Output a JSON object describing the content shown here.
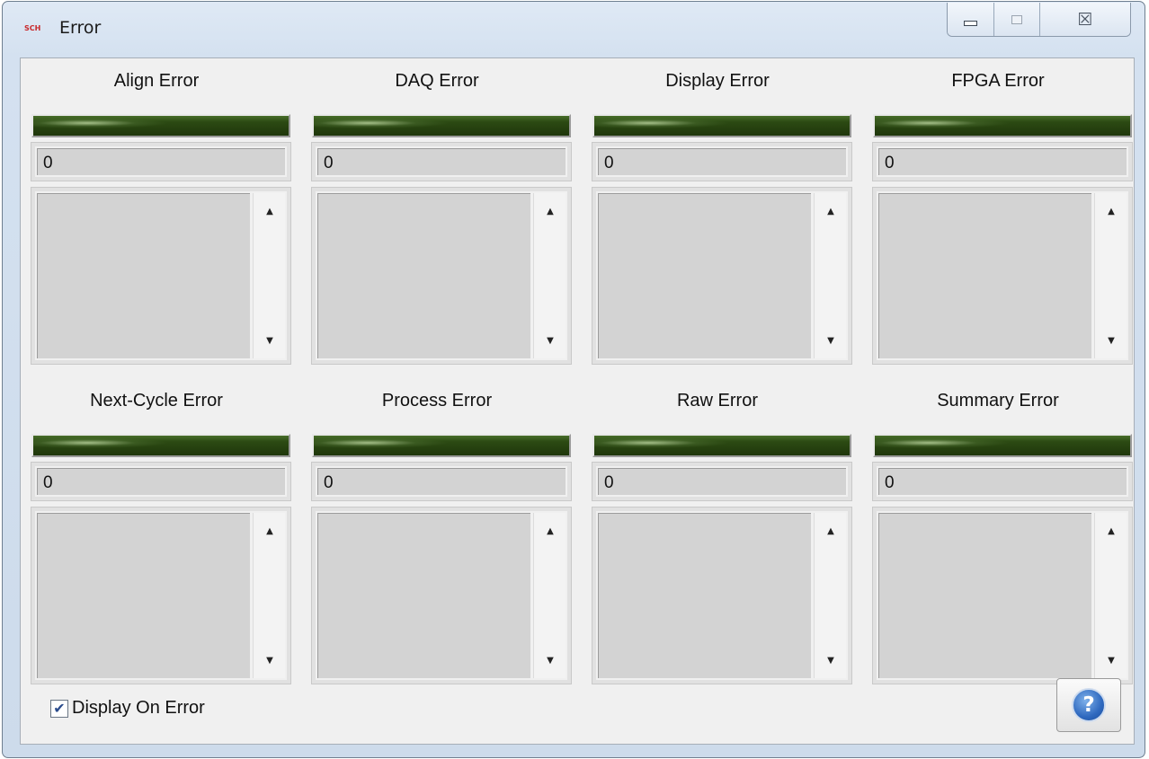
{
  "window": {
    "title": "Error",
    "icon_text": "SCH",
    "icon_name": "app-logo-icon",
    "caption": {
      "minimize_icon": "minimize-icon",
      "maximize_icon": "maximize-icon",
      "close_glyph": "☒"
    }
  },
  "tiles": [
    {
      "title": "Align Error",
      "value": "0"
    },
    {
      "title": "DAQ Error",
      "value": "0"
    },
    {
      "title": "Display Error",
      "value": "0"
    },
    {
      "title": "FPGA Error",
      "value": "0"
    },
    {
      "title": "Next-Cycle Error",
      "value": "0"
    },
    {
      "title": "Process Error",
      "value": "0"
    },
    {
      "title": "Raw Error",
      "value": "0"
    },
    {
      "title": "Summary Error",
      "value": "0"
    }
  ],
  "scroll": {
    "up_glyph": "▲",
    "down_glyph": "▼"
  },
  "display_on_error": {
    "label": "Display On Error",
    "checked_glyph": "✔"
  },
  "help": {
    "glyph": "?"
  },
  "colors": {
    "led_off": "#1f370b",
    "accent": "#2f69bf"
  }
}
